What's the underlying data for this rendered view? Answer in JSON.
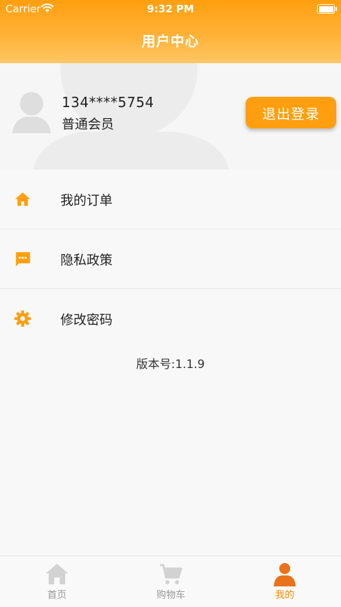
{
  "status_bar": {
    "carrier": "Carrier",
    "time": "9:32 PM"
  },
  "header": {
    "title": "用户中心"
  },
  "profile": {
    "phone": "134****5754",
    "level": "普通会员",
    "logout_label": "退出登录"
  },
  "menu": {
    "items": [
      {
        "label": "我的订单",
        "icon": "home-icon"
      },
      {
        "label": "隐私政策",
        "icon": "message-icon"
      },
      {
        "label": "修改密码",
        "icon": "gear-icon"
      }
    ]
  },
  "version_text": "版本号:1.1.9",
  "tabbar": {
    "tabs": [
      {
        "label": "首页",
        "icon": "home-icon",
        "active": false
      },
      {
        "label": "购物车",
        "icon": "cart-icon",
        "active": false
      },
      {
        "label": "我的",
        "icon": "person-icon",
        "active": true
      }
    ]
  },
  "colors": {
    "accent": "#ff9f0f",
    "active_tab": "#ff8a00",
    "inactive_tab": "#d2d2d2"
  }
}
